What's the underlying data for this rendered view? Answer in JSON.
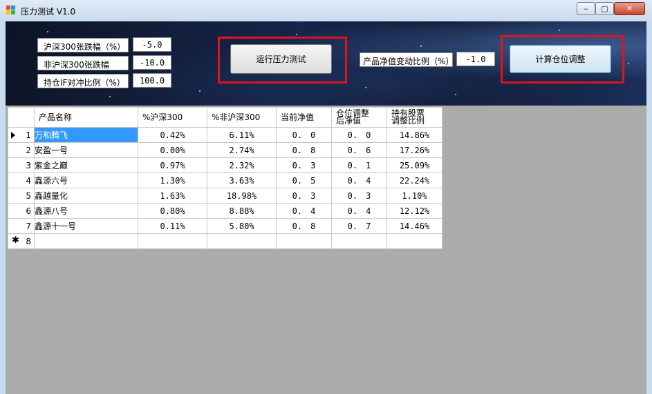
{
  "window": {
    "title": "压力测试 V1.0",
    "min": "‒",
    "max": "▢",
    "close": "✕"
  },
  "params": [
    {
      "label": "沪深300张跌幅（%）",
      "value": "-5.0"
    },
    {
      "label": "非沪深300张跌幅（%）",
      "value": "-10.0"
    },
    {
      "label": "持仓IF对冲比例（%）",
      "value": "100.0"
    }
  ],
  "run_button": "运行压力测试",
  "nav_change": {
    "label": "产品净值变动比例（%）",
    "value": "-1.0"
  },
  "calc_button": "计算仓位调整",
  "table": {
    "headers": [
      "产品名称",
      "%沪深300",
      "%非沪深300",
      "当前净值",
      "仓位调整\n后净值",
      "持有股票\n调整比例"
    ],
    "rows": [
      {
        "idx": "1",
        "name": "万和腾飞",
        "hs300": "0.42%",
        "non_hs300": "6.11%",
        "nav": "0.　0",
        "adj_nav": "0.　0",
        "ratio": "14.86%"
      },
      {
        "idx": "2",
        "name": "安盈一号",
        "hs300": "0.00%",
        "non_hs300": "2.74%",
        "nav": "0.　8",
        "adj_nav": "0.　6",
        "ratio": "17.26%"
      },
      {
        "idx": "3",
        "name": "紫金之巅",
        "hs300": "0.97%",
        "non_hs300": "2.32%",
        "nav": "0.　3",
        "adj_nav": "0.　1",
        "ratio": "25.09%"
      },
      {
        "idx": "4",
        "name": "鑫源六号",
        "hs300": "1.30%",
        "non_hs300": "3.63%",
        "nav": "0.　5",
        "adj_nav": "0.　4",
        "ratio": "22.24%"
      },
      {
        "idx": "5",
        "name": "鑫越量化",
        "hs300": "1.63%",
        "non_hs300": "18.98%",
        "nav": "0.　3",
        "adj_nav": "0.　3",
        "ratio": "1.10%"
      },
      {
        "idx": "6",
        "name": "鑫源八号",
        "hs300": "0.80%",
        "non_hs300": "8.88%",
        "nav": "0.　4",
        "adj_nav": "0.　4",
        "ratio": "12.12%"
      },
      {
        "idx": "7",
        "name": "鑫源十一号",
        "hs300": "0.11%",
        "non_hs300": "5.80%",
        "nav": "0.　8",
        "adj_nav": "0.　7",
        "ratio": "14.46%"
      }
    ],
    "new_row_idx": "8"
  }
}
